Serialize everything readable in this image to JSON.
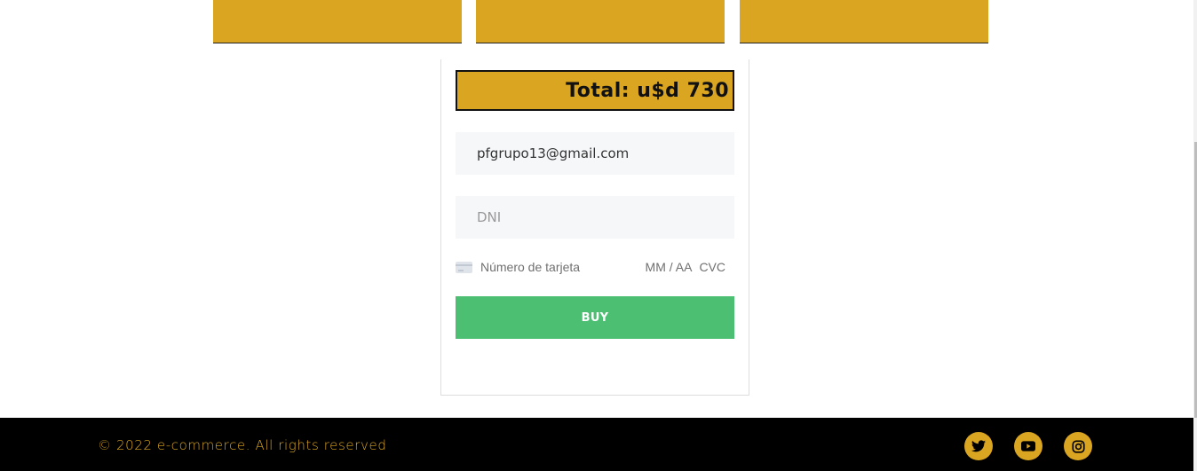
{
  "checkout": {
    "total": "Total: u$d 730",
    "email_value": "pfgrupo13@gmail.com",
    "dni_placeholder": "DNI",
    "card_number_placeholder": "Número de tarjeta",
    "card_expiry_placeholder": "MM / AA",
    "card_cvc_placeholder": "CVC",
    "buy_label": "BUY"
  },
  "footer": {
    "copyright": "© 2022 e-commerce. All rights reserved",
    "social": [
      "twitter-icon",
      "youtube-icon",
      "instagram-icon"
    ]
  },
  "colors": {
    "accent": "#daa520",
    "buy_button": "#4cbf73",
    "footer_bg": "#000000",
    "input_bg": "#f6f7f9"
  }
}
